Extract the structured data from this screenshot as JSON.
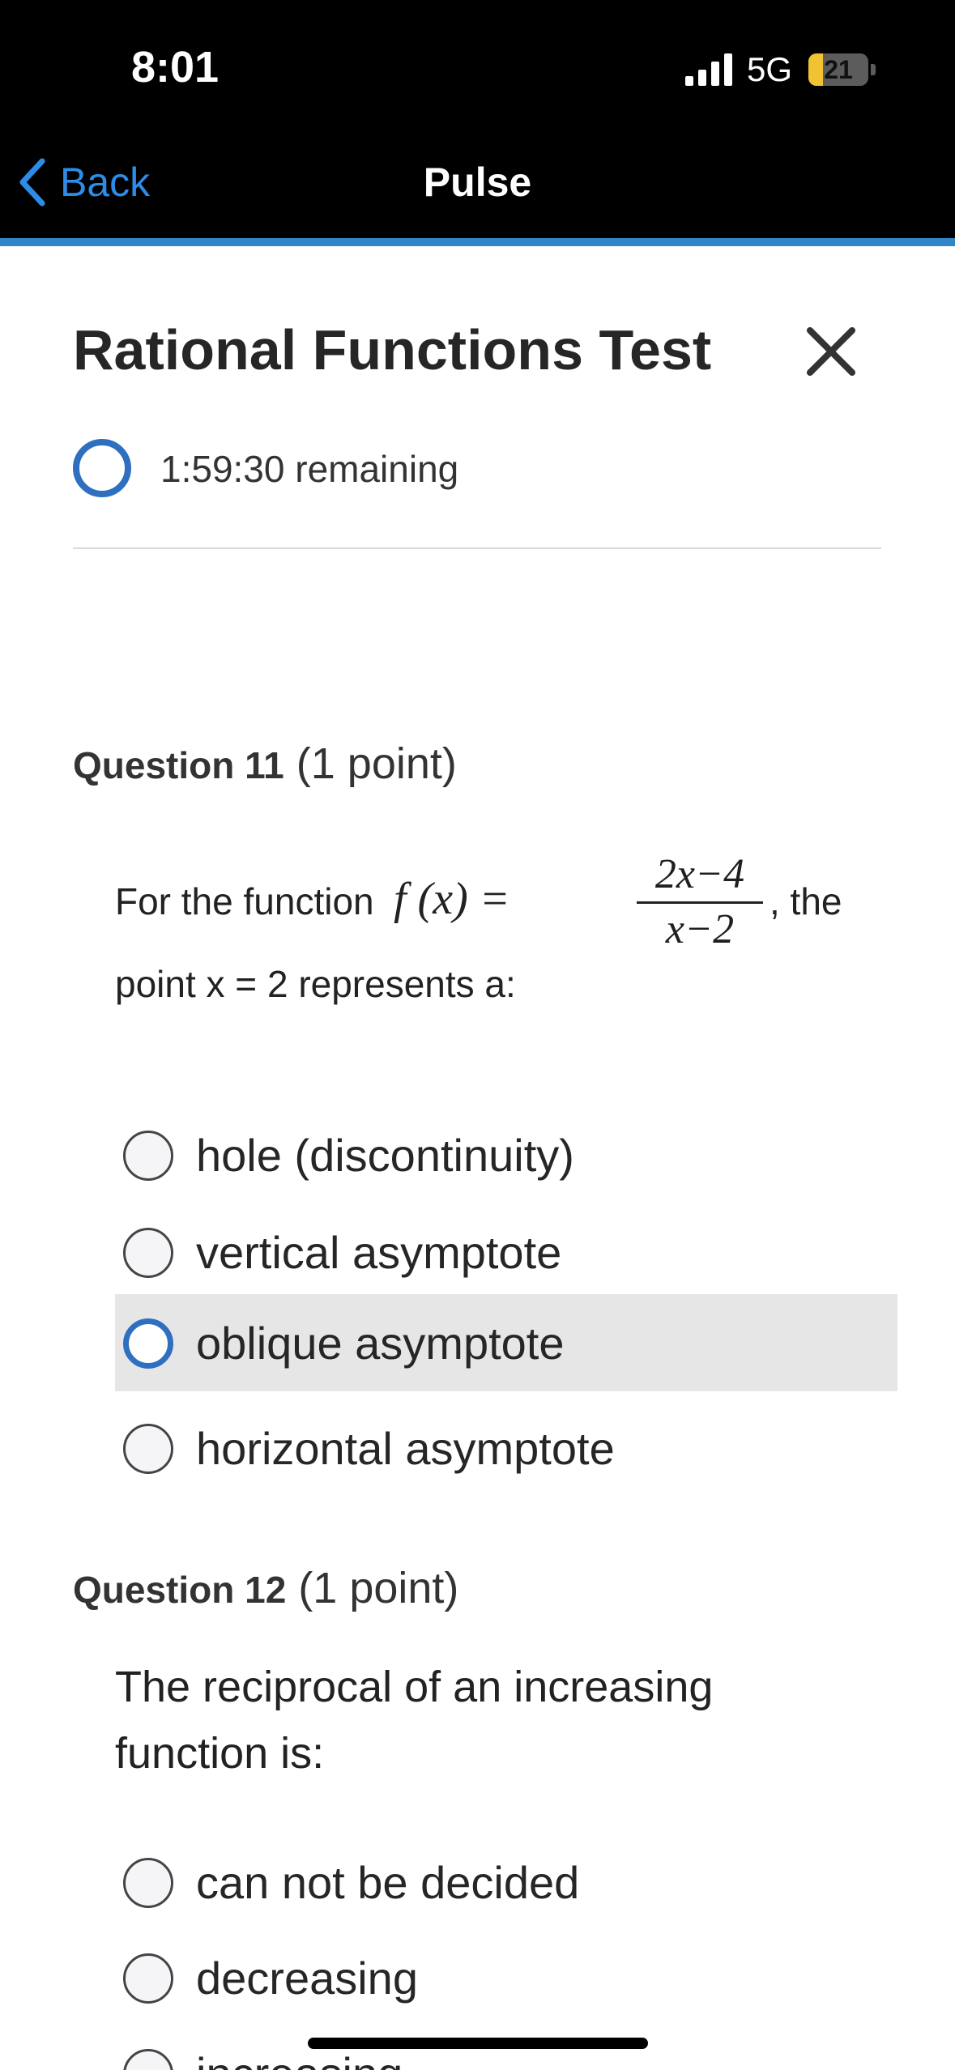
{
  "status_bar": {
    "time": "8:01",
    "network": "5G",
    "battery": "21"
  },
  "nav": {
    "back_label": "Back",
    "title": "Pulse"
  },
  "test": {
    "title": "Rational Functions Test",
    "timer_text": "1:59:30 remaining"
  },
  "questions": [
    {
      "number_label": "Question 11",
      "points_label": "(1 point)",
      "text_before": "For the function",
      "formula_lhs": "f (x) =",
      "formula_num": "2x−4",
      "formula_den": "x−2",
      "text_after": ", the",
      "text_line2": "point x = 2 represents a:",
      "options": [
        {
          "label": "hole (discontinuity)",
          "selected": false
        },
        {
          "label": "vertical asymptote",
          "selected": false
        },
        {
          "label": "oblique asymptote",
          "selected": true
        },
        {
          "label": "horizontal asymptote",
          "selected": false
        }
      ]
    },
    {
      "number_label": "Question 12",
      "points_label": "(1 point)",
      "text_line1": "The reciprocal of an increasing",
      "text_line2": "function is:",
      "options": [
        {
          "label": "can not be decided",
          "selected": false
        },
        {
          "label": "decreasing",
          "selected": false
        },
        {
          "label": "increasing",
          "selected": false
        }
      ]
    }
  ],
  "colors": {
    "accent": "#2f6fbf",
    "nav_blue": "#2f86c6",
    "back_link": "#2d8ce8",
    "selected_bg": "#e6e6e6"
  }
}
